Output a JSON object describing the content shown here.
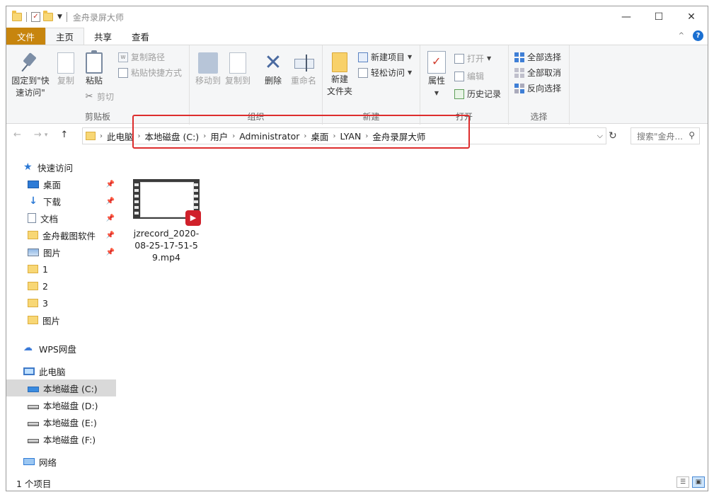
{
  "window": {
    "title": "金舟录屏大师",
    "controls": {
      "minimize": "—",
      "maximize": "☐",
      "close": "✕"
    }
  },
  "tabs": [
    {
      "label": "文件"
    },
    {
      "label": "主页"
    },
    {
      "label": "共享"
    },
    {
      "label": "查看"
    }
  ],
  "ribbon": {
    "clipboard": {
      "label": "剪贴板",
      "pin": "固定到\"快\n速访问\"",
      "copy": "复制",
      "paste": "粘贴",
      "copy_path": "复制路径",
      "paste_shortcut": "粘贴快捷方式",
      "cut": "剪切"
    },
    "organize": {
      "label": "组织",
      "move_to": "移动到",
      "copy_to": "复制到",
      "delete": "删除",
      "rename": "重命名"
    },
    "new": {
      "label": "新建",
      "new_folder_line1": "新建",
      "new_folder_line2": "文件夹",
      "new_item": "新建项目",
      "easy_access": "轻松访问"
    },
    "open": {
      "label": "打开",
      "properties": "属性",
      "open": "打开",
      "edit": "编辑",
      "history": "历史记录"
    },
    "select": {
      "label": "选择",
      "select_all": "全部选择",
      "select_none": "全部取消",
      "invert": "反向选择"
    }
  },
  "address": {
    "crumbs": [
      "此电脑",
      "本地磁盘 (C:)",
      "用户",
      "Administrator",
      "桌面",
      "LYAN",
      "金舟录屏大师"
    ]
  },
  "search": {
    "placeholder": "搜索\"金舟..."
  },
  "sidebar": {
    "items": [
      {
        "label": "快速访问",
        "icon": "star-icon"
      },
      {
        "label": "桌面",
        "icon": "desktop-icon"
      },
      {
        "label": "下载",
        "icon": "download-icon"
      },
      {
        "label": "文档",
        "icon": "document-icon"
      },
      {
        "label": "金舟截图软件",
        "icon": "folder-icon"
      },
      {
        "label": "图片",
        "icon": "pictures-icon"
      },
      {
        "label": "1",
        "icon": "folder-icon"
      },
      {
        "label": "2",
        "icon": "folder-icon"
      },
      {
        "label": "3",
        "icon": "folder-icon"
      },
      {
        "label": "图片",
        "icon": "folder-icon"
      },
      {
        "label": "WPS网盘",
        "icon": "cloud-icon"
      },
      {
        "label": "此电脑",
        "icon": "computer-icon"
      },
      {
        "label": "本地磁盘 (C:)",
        "icon": "drive-icon"
      },
      {
        "label": "本地磁盘 (D:)",
        "icon": "drive-icon"
      },
      {
        "label": "本地磁盘 (E:)",
        "icon": "drive-icon"
      },
      {
        "label": "本地磁盘 (F:)",
        "icon": "drive-icon"
      },
      {
        "label": "网络",
        "icon": "network-icon"
      }
    ]
  },
  "files": [
    {
      "name": "jzrecord_2020-08-25-17-51-59.mp4"
    }
  ],
  "status": {
    "count": "1 个项目"
  },
  "colors": {
    "file_tab": "#c7850e",
    "highlight": "#dd2d2d",
    "accent": "#2e7bd6"
  }
}
